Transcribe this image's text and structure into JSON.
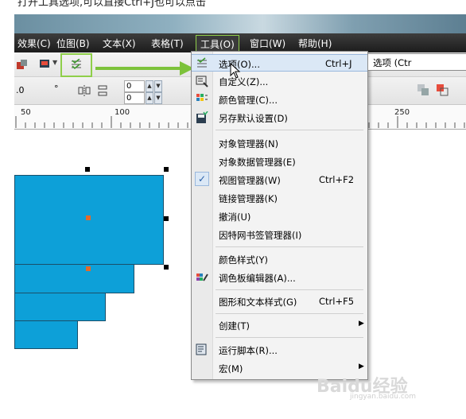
{
  "caption": "打开工具选项,可以直接Ctrl+J也可以点击",
  "menubar": {
    "items": [
      {
        "label": "效果(C)"
      },
      {
        "label": "位图(B)"
      },
      {
        "label": "文本(X)"
      },
      {
        "label": "表格(T)"
      },
      {
        "label": "工具(O)"
      },
      {
        "label": "窗口(W)"
      },
      {
        "label": "帮助(H)"
      }
    ]
  },
  "toolbar": {
    "field_left": ".0",
    "unit": "°",
    "field_top": "0",
    "field_bottom": "0"
  },
  "ruler": {
    "labels": [
      "50",
      "100",
      "250"
    ]
  },
  "dropdown": {
    "items": [
      {
        "label": "选项(O)...",
        "shortcut": "Ctrl+J",
        "icon": "options-icon"
      },
      {
        "label": "自定义(Z)...",
        "shortcut": "",
        "icon": "customize-icon"
      },
      {
        "label": "颜色管理(C)...",
        "shortcut": "",
        "icon": "color-management-icon"
      },
      {
        "label": "另存默认设置(D)",
        "shortcut": "",
        "icon": "save-defaults-icon"
      },
      {
        "label": "对象管理器(N)",
        "shortcut": "",
        "icon": ""
      },
      {
        "label": "对象数据管理器(E)",
        "shortcut": "",
        "icon": ""
      },
      {
        "label": "视图管理器(W)",
        "shortcut": "Ctrl+F2",
        "icon": "checkmark-icon"
      },
      {
        "label": "链接管理器(K)",
        "shortcut": "",
        "icon": ""
      },
      {
        "label": "撤消(U)",
        "shortcut": "",
        "icon": ""
      },
      {
        "label": "因特网书签管理器(I)",
        "shortcut": "",
        "icon": ""
      },
      {
        "label": "颜色样式(Y)",
        "shortcut": "",
        "icon": ""
      },
      {
        "label": "调色板编辑器(A)...",
        "shortcut": "",
        "icon": "palette-editor-icon"
      },
      {
        "label": "图形和文本样式(G)",
        "shortcut": "Ctrl+F5",
        "icon": ""
      },
      {
        "label": "创建(T)",
        "shortcut": "",
        "icon": "",
        "submenu": true
      },
      {
        "label": "运行脚本(R)...",
        "shortcut": "",
        "icon": "run-script-icon"
      },
      {
        "label": "宏(M)",
        "shortcut": "",
        "icon": "",
        "submenu": true
      }
    ]
  },
  "tooltip": {
    "text": "选项 (Ctr"
  },
  "watermark": {
    "text": "Baidu经验",
    "sub": "jingyan.baidu.com"
  },
  "colors": {
    "accent_green": "#8fcf4a",
    "shape_fill": "#0da0d8",
    "menu_highlight": "#dbe8f6",
    "menubar_bg": "#2a2a2a"
  }
}
